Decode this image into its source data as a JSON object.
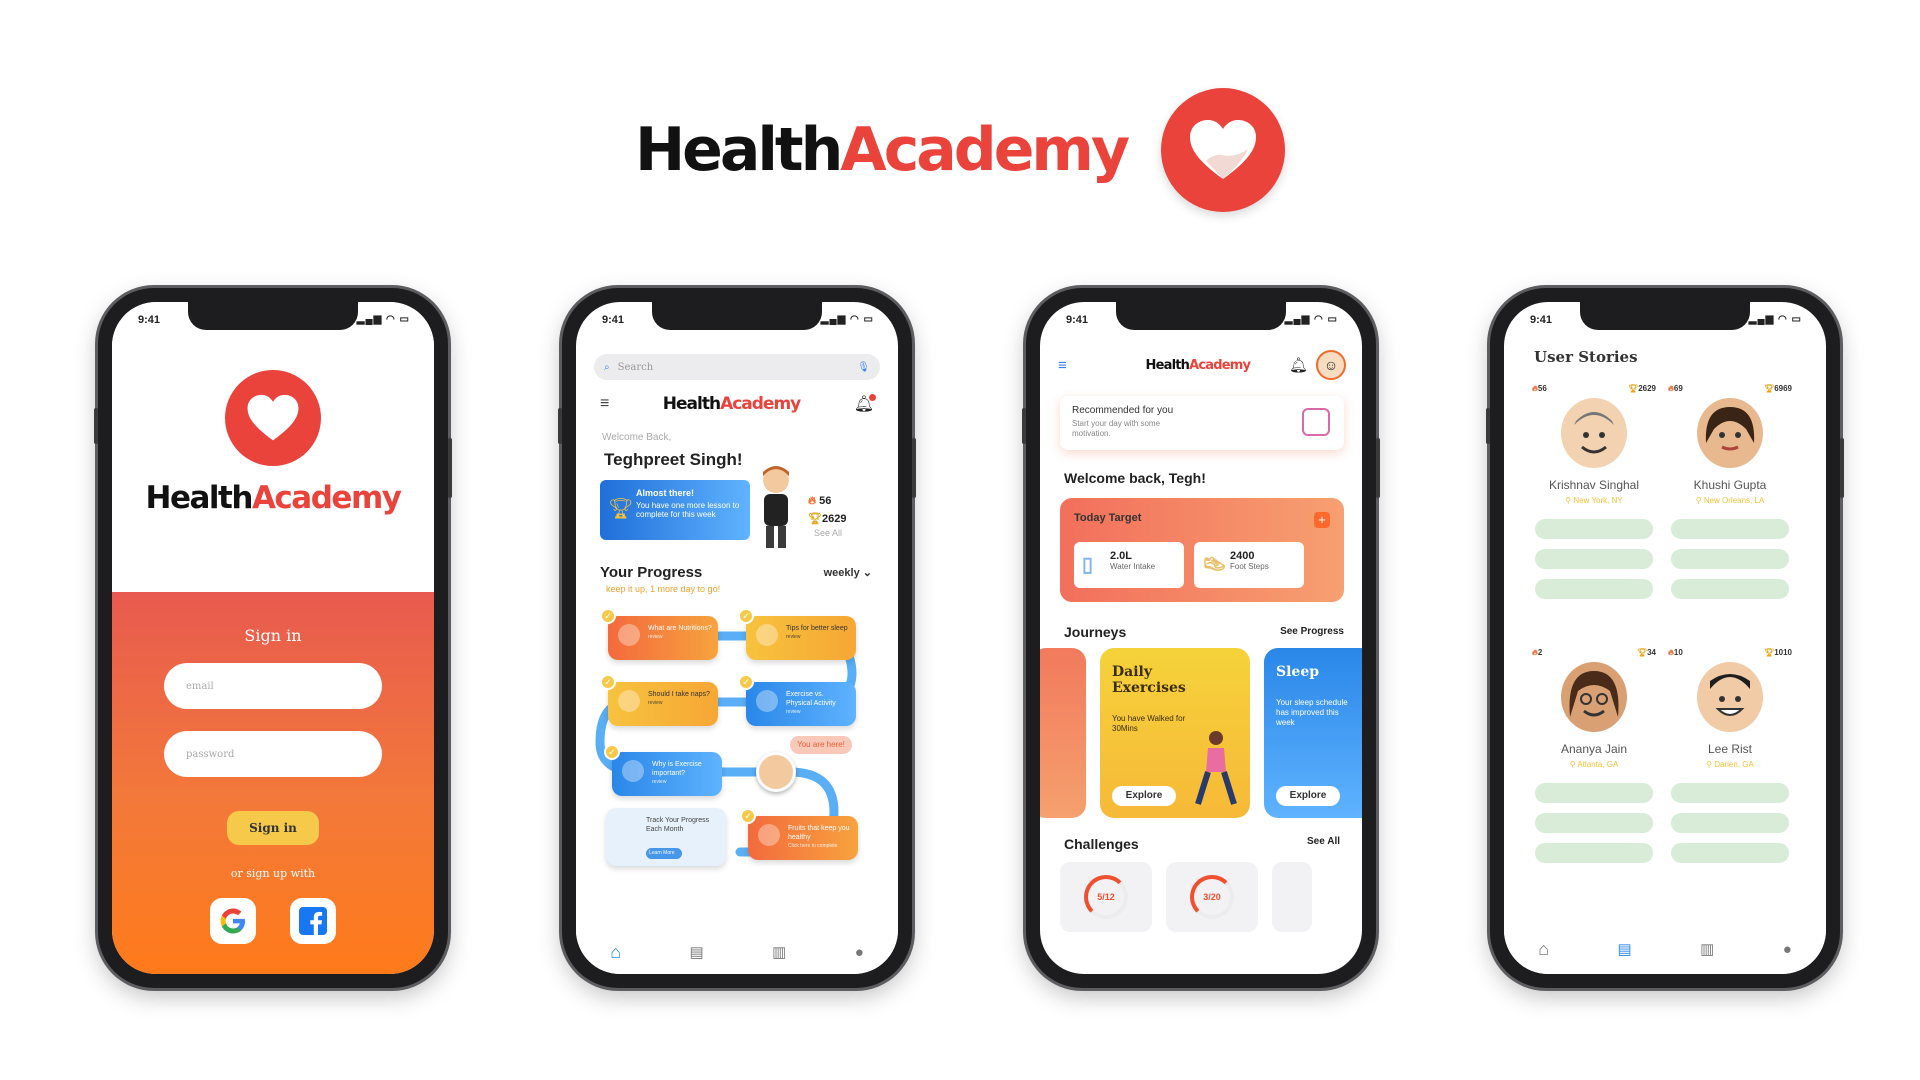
{
  "brand": {
    "name_part1": "Health",
    "name_part2": "Academy",
    "primary_color": "#e9433c"
  },
  "status": {
    "time": "9:41"
  },
  "signin": {
    "brand_part1": "Health",
    "brand_part2": "Academy",
    "title": "Sign in",
    "email_placeholder": "email",
    "password_placeholder": "password",
    "signin_label": "Sign in",
    "or_text": "or sign up with"
  },
  "home": {
    "search_placeholder": "Search",
    "brand_part1": "Health",
    "brand_part2": "Academy",
    "welcome": "Welcome Back,",
    "user_name": "Teghpreet Singh!",
    "banner_title": "Almost there!",
    "banner_text": "You have one more lesson to complete for this week",
    "streak": "56",
    "points": "2629",
    "see_all": "See All",
    "progress_title": "Your Progress",
    "period": "weekly",
    "encourage": "keep it up, 1 more day to go!",
    "lessons": [
      {
        "title": "What are Nutritions?",
        "status": "review"
      },
      {
        "title": "Tips for better sleep",
        "status": "review"
      },
      {
        "title": "Should I take naps?",
        "status": "review"
      },
      {
        "title": "Exercise vs. Physical Activity",
        "status": "review"
      },
      {
        "title": "Why is Exercise important?",
        "status": "review"
      },
      {
        "title": "Track Your Progress Each Month",
        "status": "Learn More"
      },
      {
        "title": "Fruits that keep you healthy",
        "status": "Click here to complete"
      }
    ],
    "you_are_here": "You are here!"
  },
  "dashboard": {
    "brand_part1": "Health",
    "brand_part2": "Academy",
    "reco_title": "Recommended for you",
    "reco_text": "Start your day with some motivation.",
    "welcome": "Welcome back, Tegh!",
    "target_title": "Today Target",
    "water_value": "2.0L",
    "water_label": "Water Intake",
    "steps_value": "2400",
    "steps_label": "Foot Steps",
    "journeys_title": "Journeys",
    "see_progress": "See Progress",
    "journeys": [
      {
        "title": "Daily Exercises",
        "text": "You have Walked for 30Mins",
        "cta": "Explore"
      },
      {
        "title": "Sleep",
        "text": "Your sleep schedule has improved this week",
        "cta": "Explore"
      }
    ],
    "challenges_title": "Challenges",
    "see_all": "See All",
    "challenges": [
      {
        "progress": "5/12"
      },
      {
        "progress": "3/20"
      }
    ]
  },
  "stories": {
    "title": "User Stories",
    "users": [
      {
        "name": "Krishnav Singhal",
        "location": "New York, NY",
        "streak": "56",
        "points": "2629"
      },
      {
        "name": "Khushi Gupta",
        "location": "New Orleans, LA",
        "streak": "69",
        "points": "6969"
      },
      {
        "name": "Ananya Jain",
        "location": "Atlanta, GA",
        "streak": "2",
        "points": "34"
      },
      {
        "name": "Lee Rist",
        "location": "Darien, GA",
        "streak": "10",
        "points": "1010"
      }
    ]
  }
}
